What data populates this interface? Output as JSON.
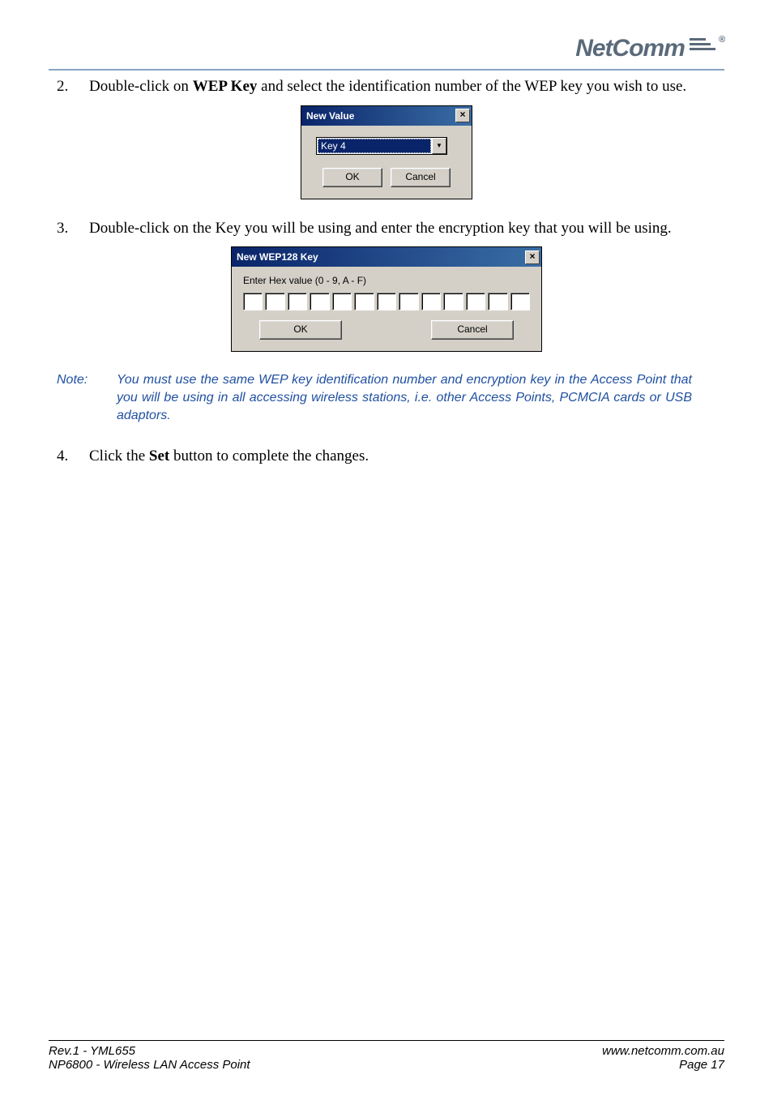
{
  "brand": {
    "name": "NetComm",
    "reg": "®"
  },
  "steps": {
    "s2": {
      "num": "2.",
      "pre": "Double-click on ",
      "bold": "WEP Key",
      "post": " and select the identification number of the WEP key you wish to use."
    },
    "s3": {
      "num": "3.",
      "text": "Double-click on the Key you will be using and enter the encryption key that you will be using."
    },
    "s4": {
      "num": "4.",
      "pre": "Click the ",
      "bold": "Set",
      "post": " button to complete the changes."
    }
  },
  "dialog1": {
    "title": "New Value",
    "close": "×",
    "selected": "Key 4",
    "dropdown": "▼",
    "ok": "OK",
    "cancel": "Cancel"
  },
  "dialog2": {
    "title": "New WEP128 Key",
    "close": "×",
    "label": "Enter Hex value (0 - 9, A - F)",
    "ok": "OK",
    "cancel": "Cancel",
    "cells": 13
  },
  "note": {
    "label": "Note:",
    "text": "You must use the same WEP key identification number and encryption key in the Access Point that you will be using in all accessing wireless stations, i.e. other Access Points, PCMCIA cards or USB adaptors."
  },
  "footer": {
    "left1": "Rev.1 - YML655",
    "left2": "NP6800 - Wireless LAN Access Point",
    "right1": "www.netcomm.com.au",
    "right2": "Page 17"
  }
}
